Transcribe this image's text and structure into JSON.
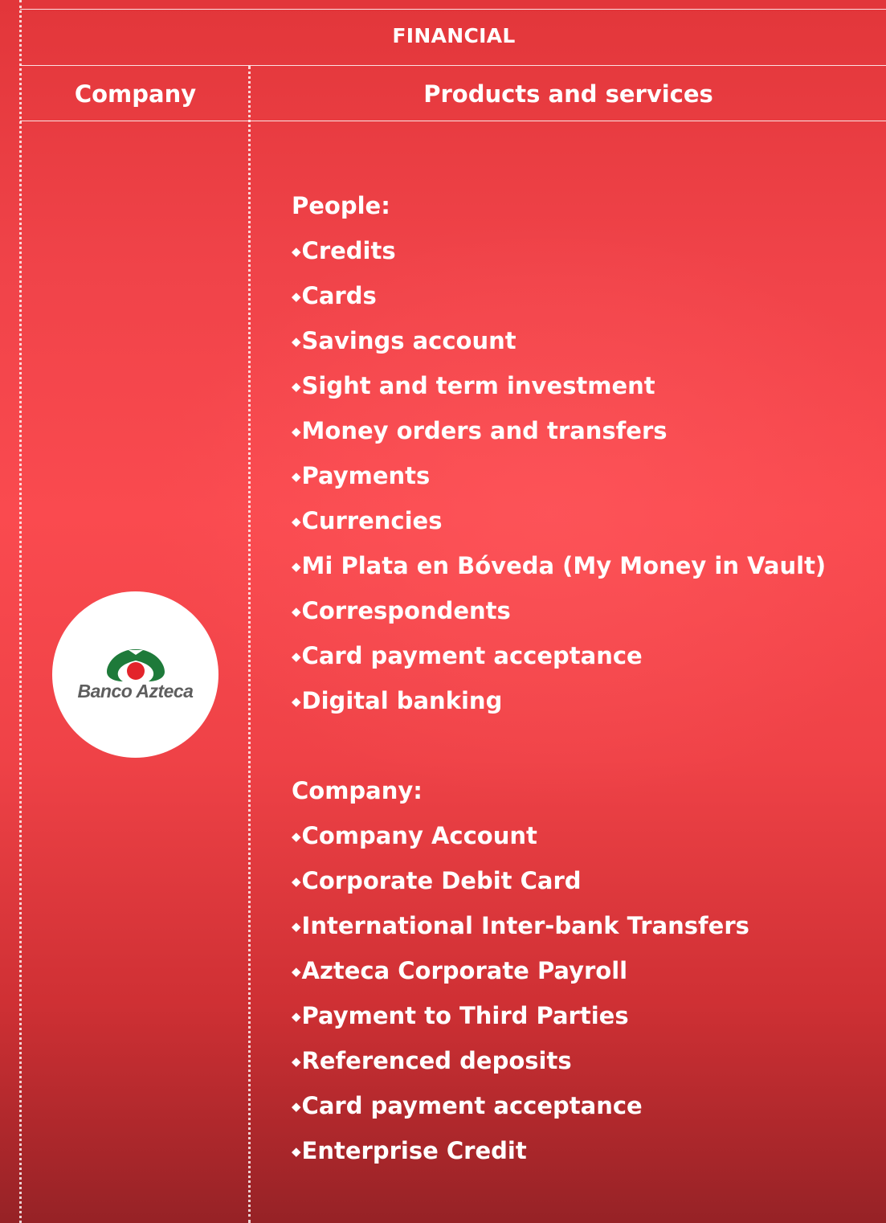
{
  "table": {
    "section_title": "FINANCIAL",
    "columns": {
      "company": "Company",
      "products": "Products and services"
    },
    "company": {
      "logo_text": "Banco Azteca",
      "logo_colors": {
        "arc": "#1e7a3a",
        "dot": "#e3242b",
        "text": "#5e5e5e"
      }
    },
    "people": {
      "heading": "People:",
      "items": [
        "Credits",
        "Cards",
        "Savings account",
        "Sight and term investment",
        "Money orders and transfers",
        "Payments",
        "Currencies",
        "Mi Plata en Bóveda (My Money in Vault)",
        "Correspondents",
        "Card payment acceptance",
        "Digital banking"
      ]
    },
    "business": {
      "heading": "Company:",
      "items": [
        "Company Account",
        "Corporate Debit Card",
        "International Inter-bank Transfers",
        "Azteca Corporate Payroll",
        "Payment to Third Parties",
        "Referenced deposits",
        "Card payment acceptance",
        "Enterprise Credit"
      ]
    },
    "bullet": "◆"
  }
}
